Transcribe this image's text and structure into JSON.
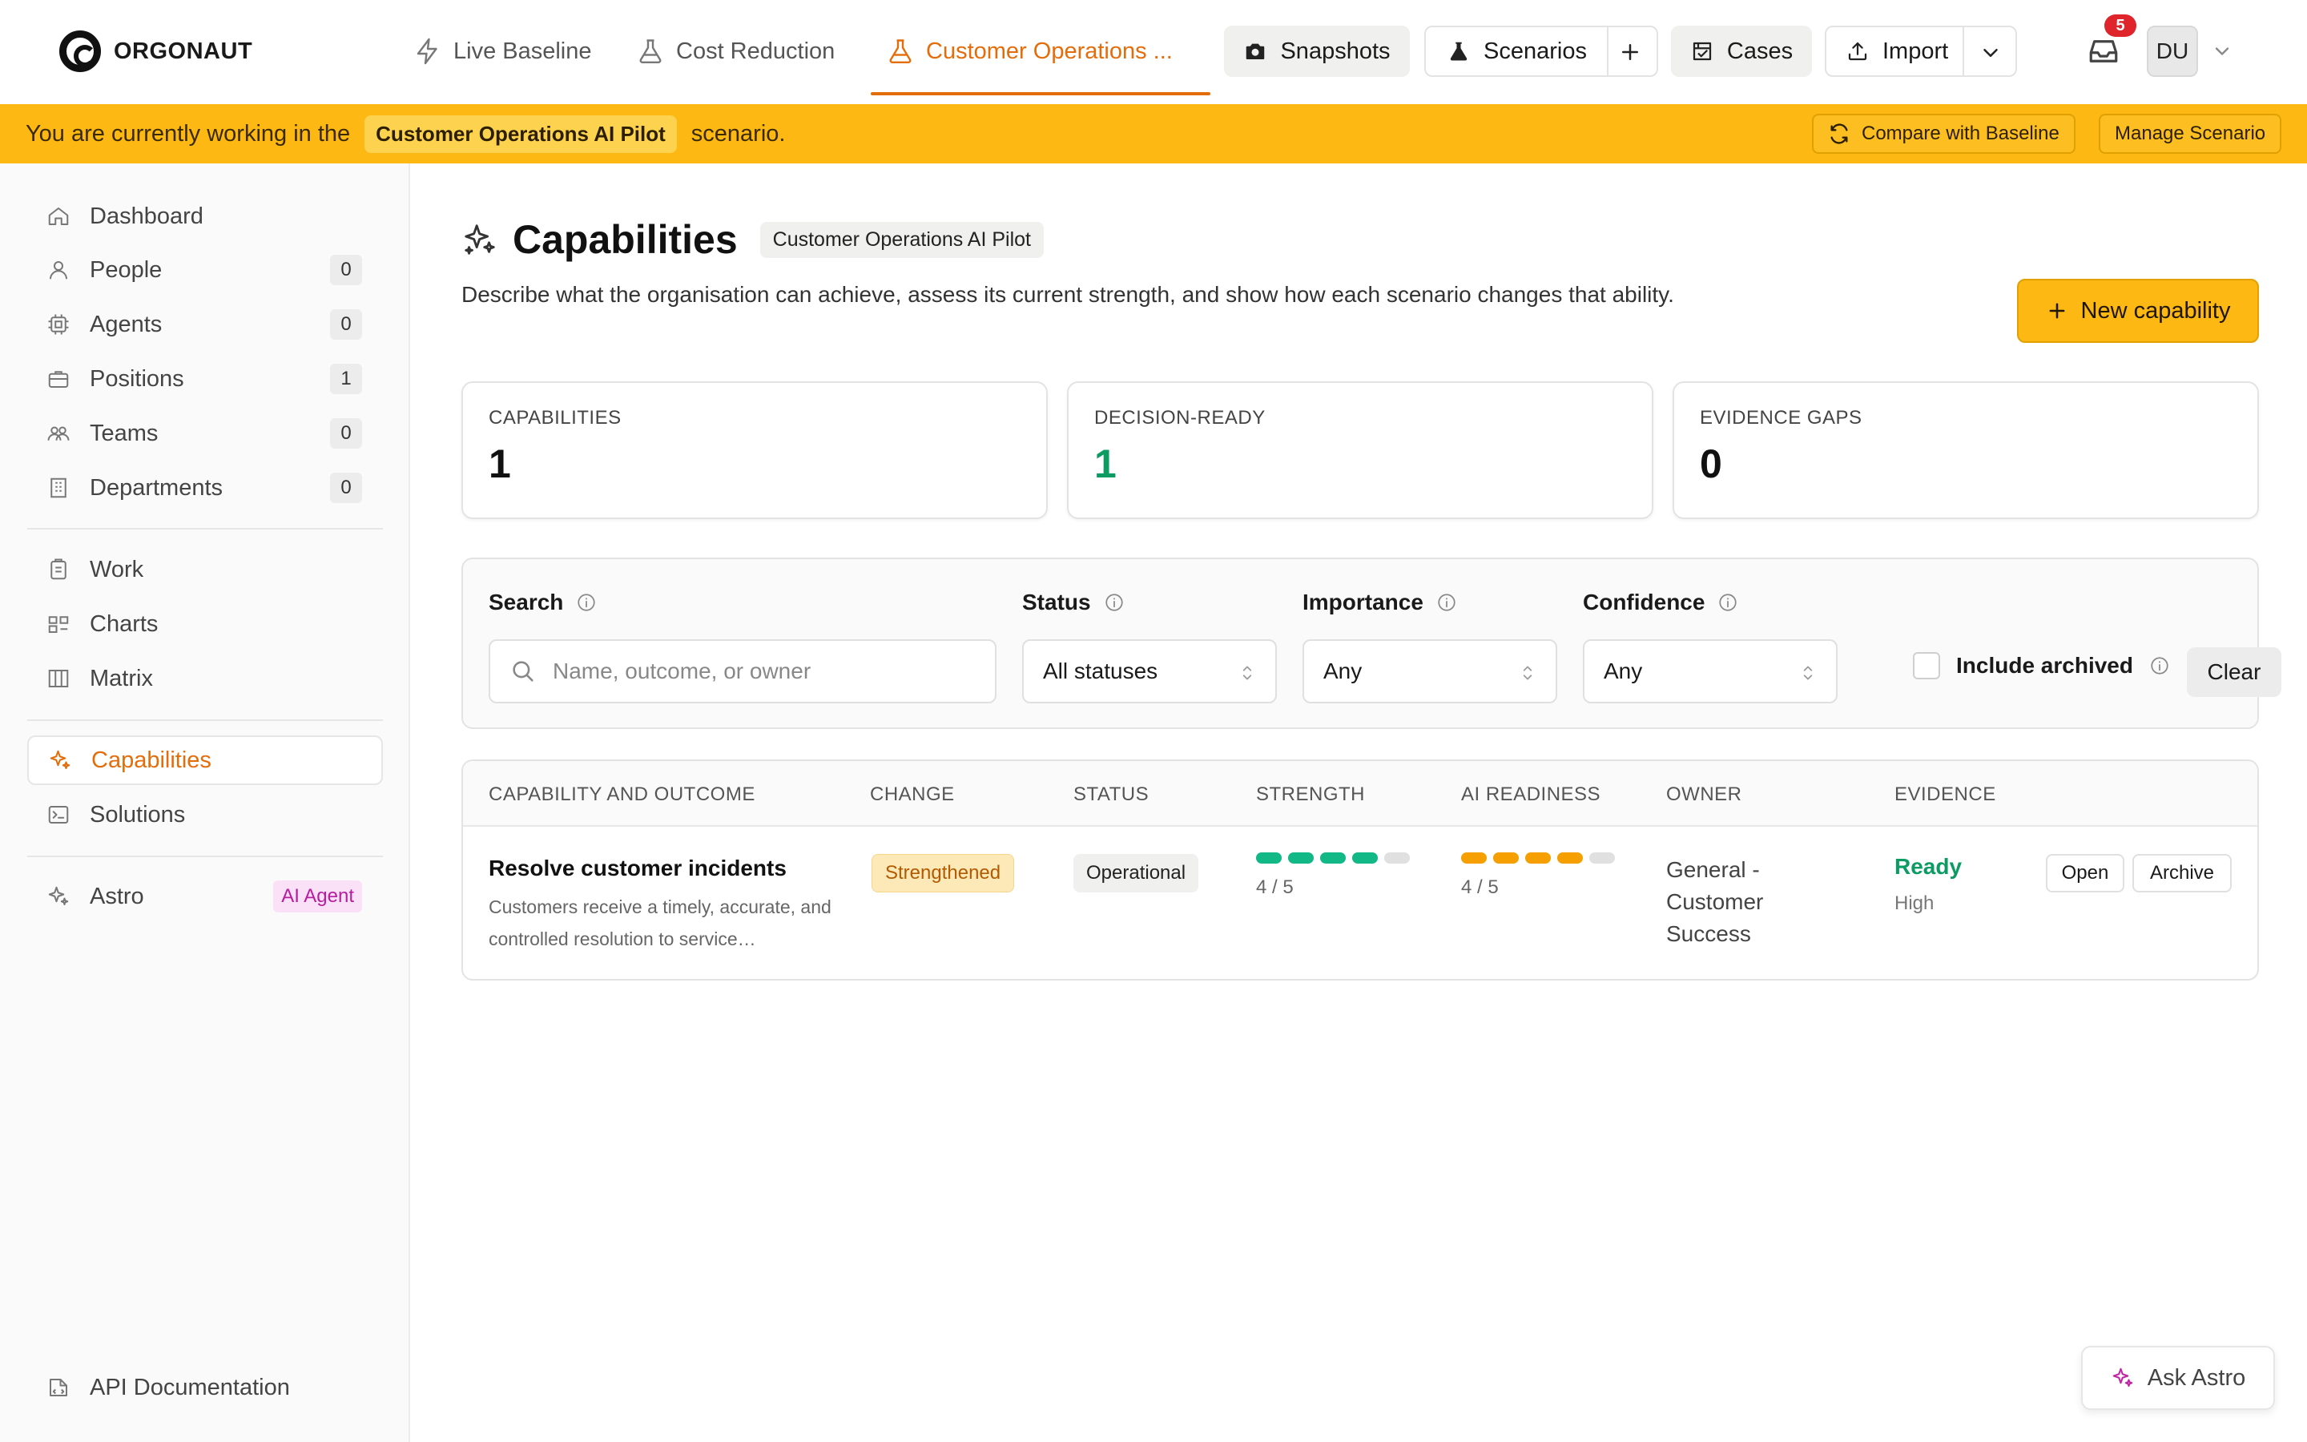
{
  "brand": {
    "name": "ORGONAUT"
  },
  "nav": {
    "tabs": [
      {
        "label": "Live Baseline",
        "icon": "lightning-icon"
      },
      {
        "label": "Cost Reduction",
        "icon": "flask-icon"
      },
      {
        "label": "Customer Operations ...",
        "icon": "flask-icon",
        "active": true
      }
    ],
    "snapshots_label": "Snapshots",
    "scenarios_label": "Scenarios",
    "cases_label": "Cases",
    "import_label": "Import",
    "notifications_count": "5",
    "user_initials": "DU"
  },
  "banner": {
    "prefix": "You are currently working in the",
    "scenario_name": "Customer Operations AI Pilot",
    "suffix": "scenario.",
    "compare_label": "Compare with Baseline",
    "manage_label": "Manage Scenario"
  },
  "sidebar": {
    "items": [
      {
        "label": "Dashboard",
        "icon": "home-icon"
      },
      {
        "label": "People",
        "icon": "person-icon",
        "count": "0"
      },
      {
        "label": "Agents",
        "icon": "chip-icon",
        "count": "0"
      },
      {
        "label": "Positions",
        "icon": "briefcase-icon",
        "count": "1"
      },
      {
        "label": "Teams",
        "icon": "team-icon",
        "count": "0"
      },
      {
        "label": "Departments",
        "icon": "building-icon",
        "count": "0"
      },
      {
        "label": "Work",
        "icon": "clipboard-icon"
      },
      {
        "label": "Charts",
        "icon": "org-chart-icon"
      },
      {
        "label": "Matrix",
        "icon": "matrix-icon"
      },
      {
        "label": "Capabilities",
        "icon": "sparkles-icon",
        "active": true
      },
      {
        "label": "Solutions",
        "icon": "terminal-icon"
      },
      {
        "label": "Astro",
        "icon": "sparkles-icon",
        "badge": "AI Agent"
      },
      {
        "label": "API Documentation",
        "icon": "api-doc-icon"
      }
    ]
  },
  "page": {
    "title": "Capabilities",
    "scenario_pill": "Customer Operations AI Pilot",
    "description": "Describe what the organisation can achieve, assess its current strength, and show how each scenario changes that ability.",
    "new_button": "New capability"
  },
  "stats": [
    {
      "label": "CAPABILITIES",
      "value": "1"
    },
    {
      "label": "DECISION-READY",
      "value": "1",
      "color": "#0c9b63"
    },
    {
      "label": "EVIDENCE GAPS",
      "value": "0"
    }
  ],
  "filters": {
    "search_label": "Search",
    "search_placeholder": "Name, outcome, or owner",
    "status_label": "Status",
    "status_value": "All statuses",
    "importance_label": "Importance",
    "importance_value": "Any",
    "confidence_label": "Confidence",
    "confidence_value": "Any",
    "include_archived_label": "Include archived",
    "include_archived": false,
    "clear_label": "Clear"
  },
  "table": {
    "columns": [
      "CAPABILITY AND OUTCOME",
      "CHANGE",
      "STATUS",
      "STRENGTH",
      "AI READINESS",
      "OWNER",
      "EVIDENCE"
    ],
    "rows": [
      {
        "name": "Resolve customer incidents",
        "outcome": "Customers receive a timely, accurate, and controlled resolution to service…",
        "change": "Strengthened",
        "status": "Operational",
        "strength": 4,
        "strength_max": 5,
        "strength_text": "4 / 5",
        "ai_readiness": 4,
        "ai_readiness_max": 5,
        "ai_readiness_text": "4 / 5",
        "owner": "General - Customer Success",
        "evidence_status": "Ready",
        "evidence_level": "High",
        "open_label": "Open",
        "archive_label": "Archive"
      }
    ]
  },
  "colors": {
    "accent": "#e46d0b",
    "banner": "#fdb813",
    "strength_fill": "#12b886",
    "ai_fill": "#f59f00",
    "empty_dot": "#e0e0e0"
  },
  "ask_astro_label": "Ask Astro"
}
